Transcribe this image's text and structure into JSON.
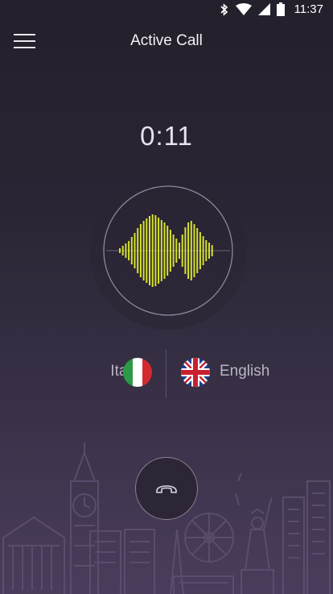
{
  "status": {
    "time": "11:37",
    "icons": [
      "bluetooth-icon",
      "wifi-icon",
      "signal-icon",
      "battery-icon"
    ]
  },
  "header": {
    "title": "Active Call",
    "menu_icon": "hamburger-menu-icon"
  },
  "call": {
    "duration": "0:11",
    "waveform_color": "#d6e12b"
  },
  "languages": {
    "source": {
      "label": "Italian",
      "flag": "italy-flag-icon"
    },
    "target": {
      "label": "English",
      "flag": "uk-flag-icon"
    }
  },
  "actions": {
    "hangup_icon": "phone-hangup-icon"
  }
}
